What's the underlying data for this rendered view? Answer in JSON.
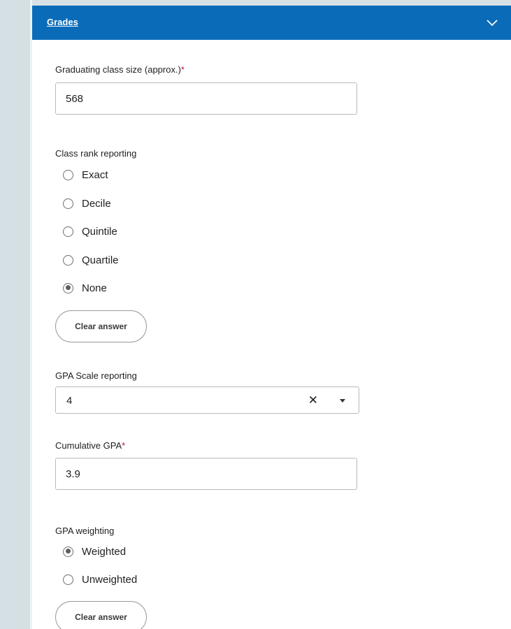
{
  "section": {
    "title": "Grades",
    "expand_icon": "chevron-down-icon",
    "header_color": "#0a6cb8"
  },
  "class_size": {
    "label": "Graduating class size (approx.)",
    "required_mark": "*",
    "value": "568"
  },
  "class_rank": {
    "label": "Class rank reporting",
    "options": [
      {
        "label": "Exact",
        "checked": false
      },
      {
        "label": "Decile",
        "checked": false
      },
      {
        "label": "Quintile",
        "checked": false
      },
      {
        "label": "Quartile",
        "checked": false
      },
      {
        "label": "None",
        "checked": true
      }
    ],
    "clear_label": "Clear answer"
  },
  "gpa_scale": {
    "label": "GPA Scale reporting",
    "value": "4",
    "clear_icon": "close-icon",
    "dropdown_icon": "caret-down-icon"
  },
  "cumulative_gpa": {
    "label": "Cumulative GPA",
    "required_mark": "*",
    "value": "3.9"
  },
  "gpa_weighting": {
    "label": "GPA weighting",
    "options": [
      {
        "label": "Weighted",
        "checked": true
      },
      {
        "label": "Unweighted",
        "checked": false
      }
    ],
    "clear_label": "Clear answer"
  },
  "colors": {
    "required": "#c8102e",
    "background": "#d7e1e5"
  }
}
